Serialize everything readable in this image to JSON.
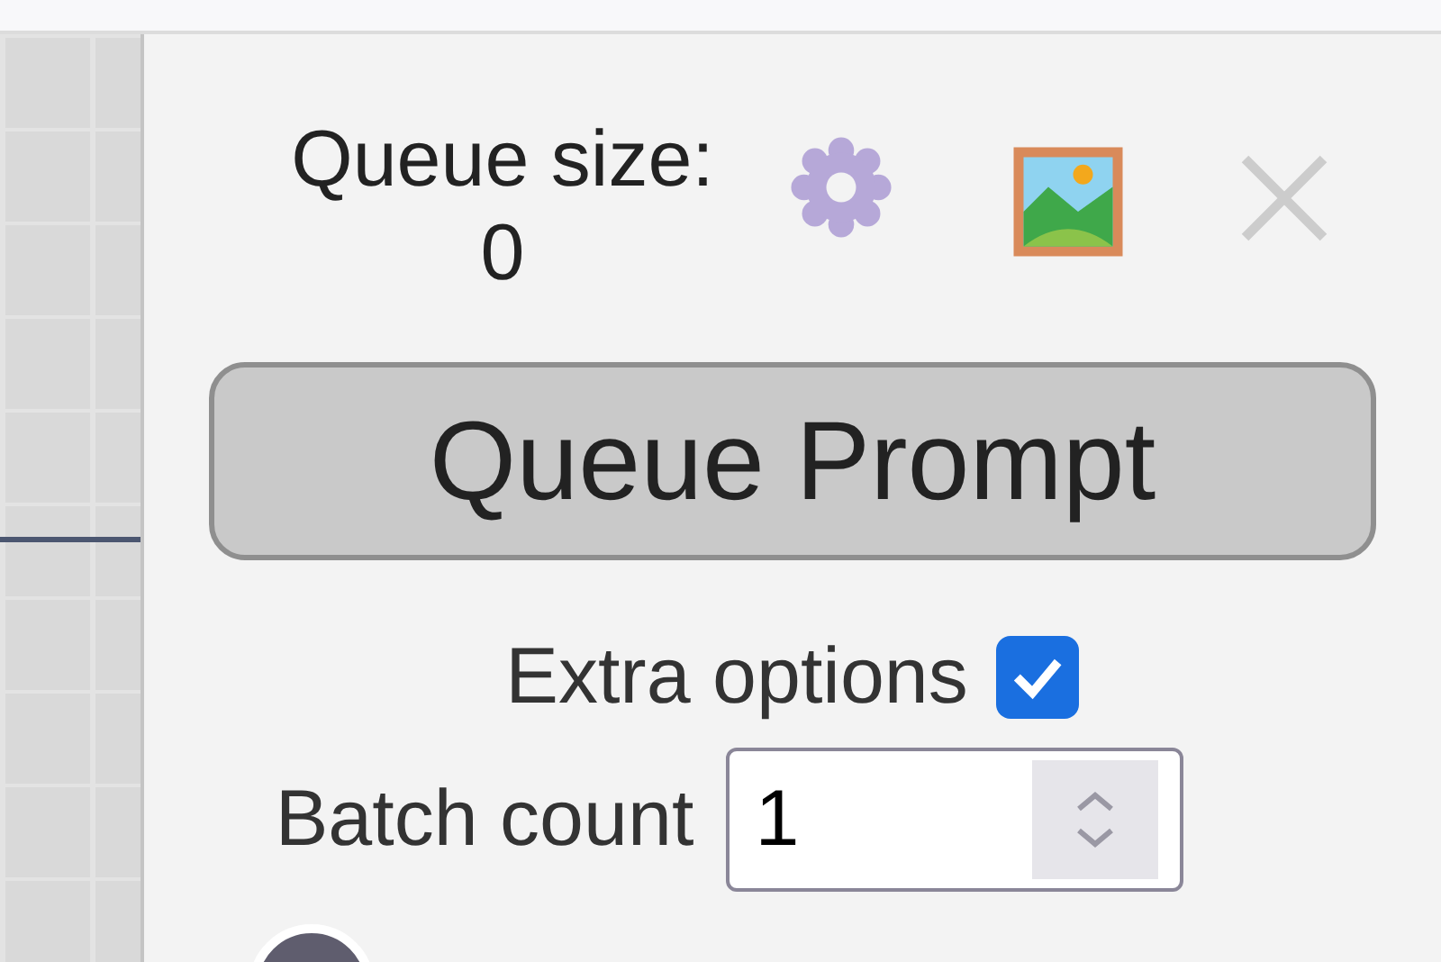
{
  "queue": {
    "label": "Queue size:",
    "count": "0"
  },
  "queue_button": {
    "label": "Queue Prompt"
  },
  "extra_options": {
    "label": "Extra options",
    "checked": true
  },
  "batch_count": {
    "label": "Batch count",
    "value": "1"
  }
}
